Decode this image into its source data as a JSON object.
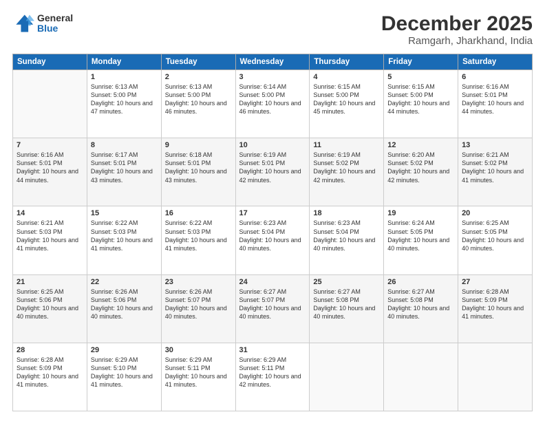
{
  "header": {
    "logo_general": "General",
    "logo_blue": "Blue",
    "main_title": "December 2025",
    "sub_title": "Ramgarh, Jharkhand, India"
  },
  "calendar": {
    "headers": [
      "Sunday",
      "Monday",
      "Tuesday",
      "Wednesday",
      "Thursday",
      "Friday",
      "Saturday"
    ],
    "rows": [
      [
        {
          "day": "",
          "sunrise": "",
          "sunset": "",
          "daylight": "",
          "empty": true
        },
        {
          "day": "1",
          "sunrise": "Sunrise: 6:13 AM",
          "sunset": "Sunset: 5:00 PM",
          "daylight": "Daylight: 10 hours and 47 minutes."
        },
        {
          "day": "2",
          "sunrise": "Sunrise: 6:13 AM",
          "sunset": "Sunset: 5:00 PM",
          "daylight": "Daylight: 10 hours and 46 minutes."
        },
        {
          "day": "3",
          "sunrise": "Sunrise: 6:14 AM",
          "sunset": "Sunset: 5:00 PM",
          "daylight": "Daylight: 10 hours and 46 minutes."
        },
        {
          "day": "4",
          "sunrise": "Sunrise: 6:15 AM",
          "sunset": "Sunset: 5:00 PM",
          "daylight": "Daylight: 10 hours and 45 minutes."
        },
        {
          "day": "5",
          "sunrise": "Sunrise: 6:15 AM",
          "sunset": "Sunset: 5:00 PM",
          "daylight": "Daylight: 10 hours and 44 minutes."
        },
        {
          "day": "6",
          "sunrise": "Sunrise: 6:16 AM",
          "sunset": "Sunset: 5:01 PM",
          "daylight": "Daylight: 10 hours and 44 minutes."
        }
      ],
      [
        {
          "day": "7",
          "sunrise": "Sunrise: 6:16 AM",
          "sunset": "Sunset: 5:01 PM",
          "daylight": "Daylight: 10 hours and 44 minutes."
        },
        {
          "day": "8",
          "sunrise": "Sunrise: 6:17 AM",
          "sunset": "Sunset: 5:01 PM",
          "daylight": "Daylight: 10 hours and 43 minutes."
        },
        {
          "day": "9",
          "sunrise": "Sunrise: 6:18 AM",
          "sunset": "Sunset: 5:01 PM",
          "daylight": "Daylight: 10 hours and 43 minutes."
        },
        {
          "day": "10",
          "sunrise": "Sunrise: 6:19 AM",
          "sunset": "Sunset: 5:01 PM",
          "daylight": "Daylight: 10 hours and 42 minutes."
        },
        {
          "day": "11",
          "sunrise": "Sunrise: 6:19 AM",
          "sunset": "Sunset: 5:02 PM",
          "daylight": "Daylight: 10 hours and 42 minutes."
        },
        {
          "day": "12",
          "sunrise": "Sunrise: 6:20 AM",
          "sunset": "Sunset: 5:02 PM",
          "daylight": "Daylight: 10 hours and 42 minutes."
        },
        {
          "day": "13",
          "sunrise": "Sunrise: 6:21 AM",
          "sunset": "Sunset: 5:02 PM",
          "daylight": "Daylight: 10 hours and 41 minutes."
        }
      ],
      [
        {
          "day": "14",
          "sunrise": "Sunrise: 6:21 AM",
          "sunset": "Sunset: 5:03 PM",
          "daylight": "Daylight: 10 hours and 41 minutes."
        },
        {
          "day": "15",
          "sunrise": "Sunrise: 6:22 AM",
          "sunset": "Sunset: 5:03 PM",
          "daylight": "Daylight: 10 hours and 41 minutes."
        },
        {
          "day": "16",
          "sunrise": "Sunrise: 6:22 AM",
          "sunset": "Sunset: 5:03 PM",
          "daylight": "Daylight: 10 hours and 41 minutes."
        },
        {
          "day": "17",
          "sunrise": "Sunrise: 6:23 AM",
          "sunset": "Sunset: 5:04 PM",
          "daylight": "Daylight: 10 hours and 40 minutes."
        },
        {
          "day": "18",
          "sunrise": "Sunrise: 6:23 AM",
          "sunset": "Sunset: 5:04 PM",
          "daylight": "Daylight: 10 hours and 40 minutes."
        },
        {
          "day": "19",
          "sunrise": "Sunrise: 6:24 AM",
          "sunset": "Sunset: 5:05 PM",
          "daylight": "Daylight: 10 hours and 40 minutes."
        },
        {
          "day": "20",
          "sunrise": "Sunrise: 6:25 AM",
          "sunset": "Sunset: 5:05 PM",
          "daylight": "Daylight: 10 hours and 40 minutes."
        }
      ],
      [
        {
          "day": "21",
          "sunrise": "Sunrise: 6:25 AM",
          "sunset": "Sunset: 5:06 PM",
          "daylight": "Daylight: 10 hours and 40 minutes."
        },
        {
          "day": "22",
          "sunrise": "Sunrise: 6:26 AM",
          "sunset": "Sunset: 5:06 PM",
          "daylight": "Daylight: 10 hours and 40 minutes."
        },
        {
          "day": "23",
          "sunrise": "Sunrise: 6:26 AM",
          "sunset": "Sunset: 5:07 PM",
          "daylight": "Daylight: 10 hours and 40 minutes."
        },
        {
          "day": "24",
          "sunrise": "Sunrise: 6:27 AM",
          "sunset": "Sunset: 5:07 PM",
          "daylight": "Daylight: 10 hours and 40 minutes."
        },
        {
          "day": "25",
          "sunrise": "Sunrise: 6:27 AM",
          "sunset": "Sunset: 5:08 PM",
          "daylight": "Daylight: 10 hours and 40 minutes."
        },
        {
          "day": "26",
          "sunrise": "Sunrise: 6:27 AM",
          "sunset": "Sunset: 5:08 PM",
          "daylight": "Daylight: 10 hours and 40 minutes."
        },
        {
          "day": "27",
          "sunrise": "Sunrise: 6:28 AM",
          "sunset": "Sunset: 5:09 PM",
          "daylight": "Daylight: 10 hours and 41 minutes."
        }
      ],
      [
        {
          "day": "28",
          "sunrise": "Sunrise: 6:28 AM",
          "sunset": "Sunset: 5:09 PM",
          "daylight": "Daylight: 10 hours and 41 minutes."
        },
        {
          "day": "29",
          "sunrise": "Sunrise: 6:29 AM",
          "sunset": "Sunset: 5:10 PM",
          "daylight": "Daylight: 10 hours and 41 minutes."
        },
        {
          "day": "30",
          "sunrise": "Sunrise: 6:29 AM",
          "sunset": "Sunset: 5:11 PM",
          "daylight": "Daylight: 10 hours and 41 minutes."
        },
        {
          "day": "31",
          "sunrise": "Sunrise: 6:29 AM",
          "sunset": "Sunset: 5:11 PM",
          "daylight": "Daylight: 10 hours and 42 minutes."
        },
        {
          "day": "",
          "sunrise": "",
          "sunset": "",
          "daylight": "",
          "empty": true
        },
        {
          "day": "",
          "sunrise": "",
          "sunset": "",
          "daylight": "",
          "empty": true
        },
        {
          "day": "",
          "sunrise": "",
          "sunset": "",
          "daylight": "",
          "empty": true
        }
      ]
    ]
  }
}
